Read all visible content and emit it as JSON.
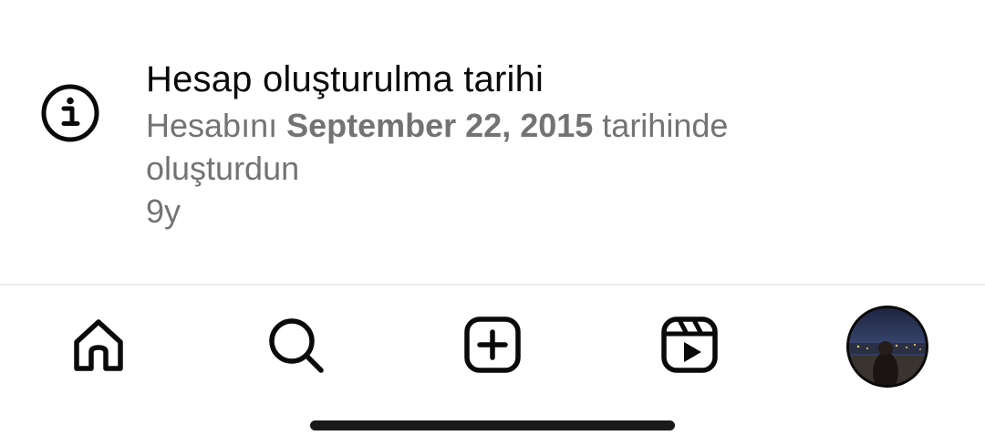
{
  "account_info": {
    "icon": "info-circle-icon",
    "title": "Hesap oluşturulma tarihi",
    "desc_prefix": "Hesabını ",
    "desc_date": "September 22, 2015",
    "desc_suffix": " tarihinde oluşturdun",
    "age": "9y"
  },
  "tabbar": {
    "items": [
      {
        "name": "home",
        "icon": "home-icon"
      },
      {
        "name": "search",
        "icon": "search-icon"
      },
      {
        "name": "create",
        "icon": "plus-square-icon"
      },
      {
        "name": "reels",
        "icon": "reels-icon"
      },
      {
        "name": "profile",
        "icon": "avatar"
      }
    ]
  },
  "colors": {
    "text_primary": "#0a0a0a",
    "text_secondary": "#737373",
    "divider": "#ececec",
    "home_indicator": "#1a1a1a"
  }
}
